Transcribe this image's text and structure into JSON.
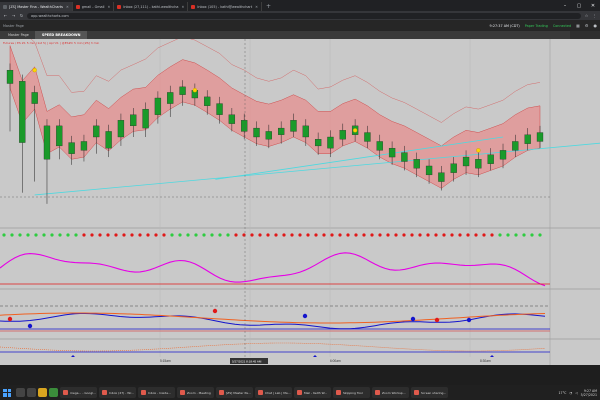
{
  "browser": {
    "tabs": [
      {
        "label": "[ZS] Master Fina - WealthCharts",
        "active": true
      },
      {
        "label": "gmail - Gmail",
        "active": false
      },
      {
        "label": "Inbox (27,111) - kathi.wealthcha",
        "active": false
      },
      {
        "label": "Inbox (105) - kathi@wealthchart",
        "active": false
      }
    ],
    "url": "app.wealthcharts.com"
  },
  "app": {
    "toolbar_left": "Master Page",
    "clock": "9:27:37 AM",
    "time_zone": "(CDT)",
    "paper_trading": "Paper Trading",
    "connection": "Connected"
  },
  "chart_tabs": [
    {
      "label": "Master Page",
      "active": false
    },
    {
      "label": "SPEED BREAKDOWN",
      "active": true
    }
  ],
  "chart_info": "Futures / ES Z1 5 min (1st 5) | Apr'21 | @ES#C 5 min [ZS] 3 min",
  "crosshair_time": "5/27/2021 8:18:45 AM",
  "time_labels": [
    "5:15am",
    "6:00am",
    "8:30am"
  ],
  "colors": {
    "bull": "#1a9a2a",
    "bear": "#e01919",
    "cloud": "#e88b8b",
    "cloud_edge": "#c33",
    "magenta": "#e600e6",
    "cyan": "#4dd9e0",
    "blue": "#1414cc",
    "orange": "#f06020",
    "chart_bg": "#c9c9c9"
  },
  "taskbar": {
    "items": [
      "mega... - Googl...",
      "Inbox (27) - Wr...",
      "Inbox - Inside...",
      "Zoom - Meeting",
      "[ZS] Master Pa...",
      "Chat | Lab | Ma...",
      "Mail - Keith W...",
      "Skipping Tool",
      "Zoom Worksp...",
      "Screen sharing..."
    ],
    "temperature": "17°C",
    "time": "9:27 AM",
    "date": "5/27/2021"
  },
  "chart_data": {
    "type": "candlestick",
    "price_panel": {
      "candles": [
        [
          8,
          52,
          40,
          95
        ],
        [
          9,
          105,
          50,
          150
        ],
        [
          10,
          70,
          60,
          140
        ],
        [
          11,
          120,
          90,
          160
        ],
        [
          12,
          108,
          90,
          120
        ],
        [
          13,
          115,
          105,
          125
        ],
        [
          14,
          112,
          104,
          122
        ],
        [
          15,
          100,
          90,
          115
        ],
        [
          16,
          110,
          95,
          118
        ],
        [
          17,
          100,
          85,
          108
        ],
        [
          18,
          90,
          80,
          100
        ],
        [
          19,
          92,
          75,
          100
        ],
        [
          20,
          80,
          65,
          88
        ],
        [
          21,
          70,
          60,
          82
        ],
        [
          22,
          62,
          55,
          72
        ],
        [
          23,
          65,
          58,
          72
        ],
        [
          24,
          72,
          64,
          80
        ],
        [
          25,
          80,
          70,
          88
        ],
        [
          26,
          88,
          80,
          95
        ],
        [
          27,
          95,
          85,
          102
        ],
        [
          28,
          100,
          92,
          108
        ],
        [
          29,
          102,
          95,
          110
        ],
        [
          30,
          98,
          92,
          106
        ],
        [
          31,
          95,
          85,
          100
        ],
        [
          32,
          100,
          90,
          108
        ],
        [
          33,
          108,
          102,
          116
        ],
        [
          34,
          110,
          100,
          118
        ],
        [
          35,
          102,
          94,
          108
        ],
        [
          36,
          98,
          90,
          104
        ],
        [
          37,
          104,
          96,
          110
        ],
        [
          38,
          112,
          104,
          120
        ],
        [
          39,
          118,
          110,
          125
        ],
        [
          40,
          122,
          114,
          130
        ],
        [
          41,
          128,
          120,
          136
        ],
        [
          42,
          134,
          126,
          142
        ],
        [
          43,
          140,
          132,
          148
        ],
        [
          44,
          132,
          124,
          140
        ],
        [
          45,
          126,
          118,
          134
        ],
        [
          46,
          128,
          120,
          136
        ],
        [
          47,
          124,
          116,
          130
        ],
        [
          48,
          120,
          112,
          128
        ],
        [
          49,
          112,
          104,
          118
        ],
        [
          50,
          106,
          98,
          112
        ],
        [
          51,
          104,
          96,
          110
        ]
      ],
      "trend_lines": [
        {
          "from": [
            25,
            138
          ],
          "to": [
            60,
            100
          ]
        },
        {
          "from": [
            3,
            152
          ],
          "to": [
            80,
            100
          ]
        }
      ]
    },
    "oscillator": {
      "color": "magenta",
      "levels": [
        80,
        20
      ]
    },
    "momentum": {
      "series": [
        "blue",
        "orange"
      ]
    },
    "histogram": {
      "series": [
        "orange"
      ]
    }
  }
}
